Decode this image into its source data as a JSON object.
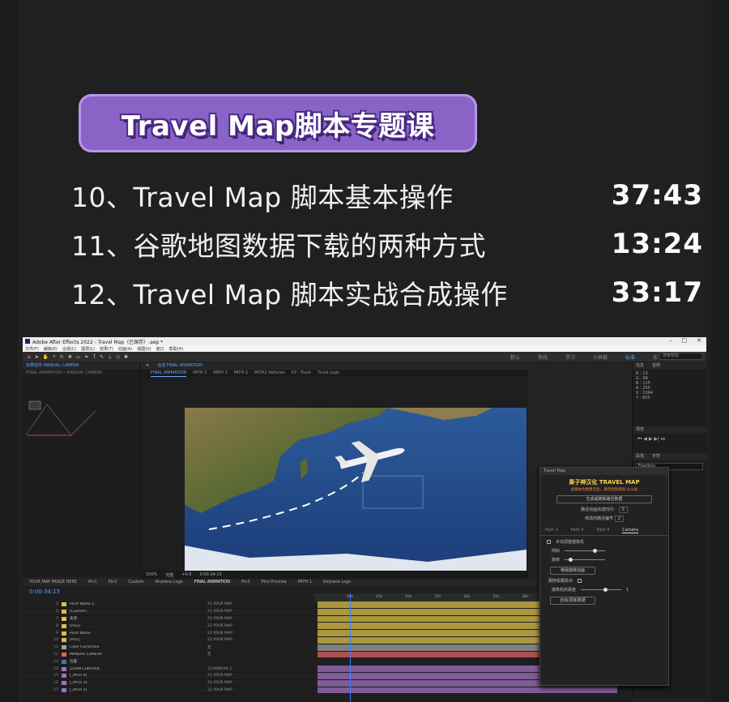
{
  "header": {
    "badge_title": "Travel Map脚本专题课"
  },
  "lessons": [
    {
      "title": "10、Travel Map 脚本基本操作",
      "duration": "37:43"
    },
    {
      "title": "11、谷歌地图数据下载的两种方式",
      "duration": "13:24"
    },
    {
      "title": "12、Travel Map 脚本实战合成操作",
      "duration": "33:17"
    }
  ],
  "app": {
    "window_title": "Adobe After Effects 2022 - Travel Map（已保存）.aep *",
    "menu": [
      "文件(F)",
      "编辑(E)",
      "合成(C)",
      "图层(L)",
      "效果(T)",
      "动画(A)",
      "视图(V)",
      "窗口",
      "帮助(H)"
    ],
    "workspaces": [
      "默认",
      "审阅",
      "学习",
      "小屏幕",
      "标准",
      "库"
    ],
    "active_workspace": "标准",
    "search_placeholder": "搜索帮助",
    "effects_panel_title": "效果控件 MANUAL CAMERA",
    "effects_panel_sub": "FINAL ANIMATION • MANUAL CAMERA",
    "comp_tab": "合成 FINAL ANIMATION",
    "comp_crumbs": [
      "FINAL ANIMATION",
      "PATH 3",
      "PATH 3",
      "PATH 2",
      "PATH2 Vehicles",
      "P2 - Truck",
      "Truck Logo"
    ],
    "viewer_footer": [
      "100%",
      "完整",
      "+0.0",
      "0:00:34:15"
    ],
    "current_time": "0:00:34:15",
    "timeline_tabs": [
      "YOUR MAP IMAGE HERE",
      "Pin1",
      "Pin2",
      "Custom",
      "Airplane Logo",
      "FINAL ANIMATION",
      "Pin3",
      "Pins Preview",
      "PATH 1",
      "Airplane Logo"
    ],
    "ruler_labels": [
      "00s",
      "05s",
      "10s",
      "15s",
      "20s",
      "25s",
      "30s",
      "35s",
      "40s"
    ],
    "info_panel": {
      "head": [
        "信息",
        "音频"
      ],
      "lines": [
        "R : 13",
        "G : 66",
        "B : 115",
        "A : 255",
        "X : 1094",
        "Y : 603"
      ]
    },
    "right_tabs": [
      "预览",
      "段落",
      "字符"
    ],
    "char_font": "Fixedsys"
  },
  "layers": [
    {
      "num": "5",
      "name": "Point Name 2",
      "color": "#d9c04a",
      "parent": "21.YOUR MAP"
    },
    {
      "num": "6",
      "name": "[Custom]",
      "color": "#d9c04a",
      "parent": "21.YOUR MAP"
    },
    {
      "num": "7",
      "name": "表演",
      "color": "#d9c04a",
      "parent": "21.YOUR MAP"
    },
    {
      "num": "8",
      "name": "[Pin2]",
      "color": "#d9c04a",
      "parent": "21.YOUR MAP"
    },
    {
      "num": "9",
      "name": "Point Name",
      "color": "#d9c04a",
      "parent": "21.YOUR MAP"
    },
    {
      "num": "10",
      "name": "[Pin1]",
      "color": "#d9c04a",
      "parent": "21.YOUR MAP"
    },
    {
      "num": "11",
      "name": "Color Correction",
      "color": "#a0a0a0",
      "parent": "无"
    },
    {
      "num": "12",
      "name": "MANUAL CAMERA",
      "color": "#e06060",
      "parent": "无"
    },
    {
      "num": "13",
      "name": "位置",
      "color": "#3c7ab8",
      "parent": ""
    },
    {
      "num": "14",
      "name": "ZOOM CONTROL",
      "color": "#a070c0",
      "parent": "13.MANUAL C"
    },
    {
      "num": "15",
      "name": "[_PATH 4]",
      "color": "#a070c0",
      "parent": "21.YOUR MAP"
    },
    {
      "num": "16",
      "name": "[_PATH 3]",
      "color": "#a070c0",
      "parent": "21.YOUR MAP"
    },
    {
      "num": "17",
      "name": "[_PATH 2]",
      "color": "#a070c0",
      "parent": "21.YOUR MAP"
    }
  ],
  "plugin": {
    "window_title": "Travel Map",
    "logo": "果子神汉化 TRAVEL MAP",
    "logo_sub": "此脚本为免费汉化，请勿出售倒卖-么么哒",
    "generate_button": "生成或刷新路径数据",
    "path_time_label": "路径动画完成时间：",
    "path_time_value": "5",
    "path_index_label": "修改的路径编号",
    "path_index_value": "2",
    "tabs": [
      "Path 2",
      "Path 3",
      "Path 4",
      "Camera"
    ],
    "active_tab": "Camera",
    "manual_camera": "手动调整摄像机",
    "tilt_label": "倾斜",
    "rotate_label": "旋转",
    "remove_button": "移除旋转动画",
    "keyframe_label": "跟随看跟踪点",
    "camera_speed_label": "摄像机的柔度",
    "camera_speed_value": "1",
    "refresh_button": "自动/更新数据"
  }
}
